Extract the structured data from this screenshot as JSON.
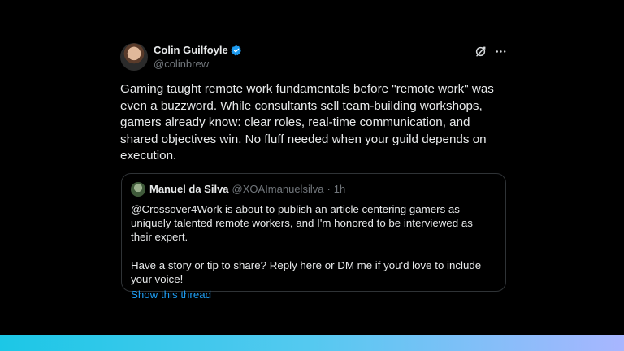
{
  "tweet": {
    "author": {
      "display_name": "Colin Guilfoyle",
      "handle": "@colinbrew",
      "verified": true
    },
    "text": "Gaming taught remote work fundamentals before \"remote work\" was even a buzzword. While consultants sell team-building workshops, gamers already know: clear roles, real-time communication, and shared objectives win. No fluff needed when your guild depends on execution.",
    "actions": [
      "grok-icon",
      "more-icon"
    ]
  },
  "quote": {
    "author": {
      "display_name": "Manuel da Silva",
      "handle": "@XOAImanuelsilva",
      "time": "1h",
      "separator": "·"
    },
    "text": "@Crossover4Work is about to publish an article centering gamers as uniquely talented remote workers, and I'm honored to be interviewed as their expert.\n\nHave a story or tip to share? Reply here or DM me if you'd love to include your voice!",
    "link_label": "Show this thread"
  },
  "colors": {
    "background": "#000000",
    "text": "#e7e9ea",
    "muted": "#71767b",
    "link": "#1d9bf0",
    "verified": "#1d9bf0",
    "border": "#2f3336",
    "bar_gradient": [
      "#1cc7e6",
      "#a8b6ff"
    ]
  }
}
